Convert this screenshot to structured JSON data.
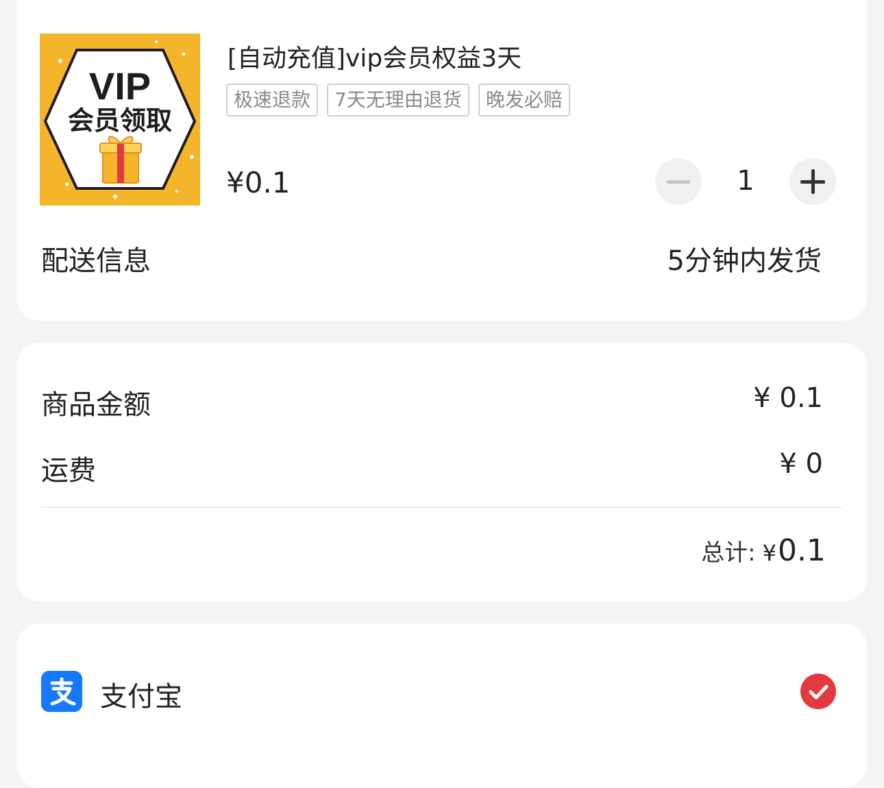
{
  "product": {
    "thumbnail": {
      "line1": "VIP",
      "line2": "会员领取"
    },
    "title": "[自动充值]vip会员权益3天",
    "tags": [
      "极速退款",
      "7天无理由退货",
      "晚发必赔"
    ],
    "price": "¥0.1",
    "quantity": "1",
    "delivery_label": "配送信息",
    "delivery_value": "5分钟内发货"
  },
  "summary": {
    "goods_amount_label": "商品金额",
    "goods_amount_value": "¥ 0.1",
    "shipping_label": "运费",
    "shipping_value": "¥ 0",
    "total_label": "总计:",
    "total_symbol": "¥",
    "total_amount": "0.1"
  },
  "payment": {
    "method_name": "支付宝",
    "icon": "alipay-icon",
    "selected": true
  },
  "colors": {
    "accent_red": "#e23a3f",
    "alipay_blue": "#1677ff",
    "thumb_yellow": "#f5b52b"
  }
}
